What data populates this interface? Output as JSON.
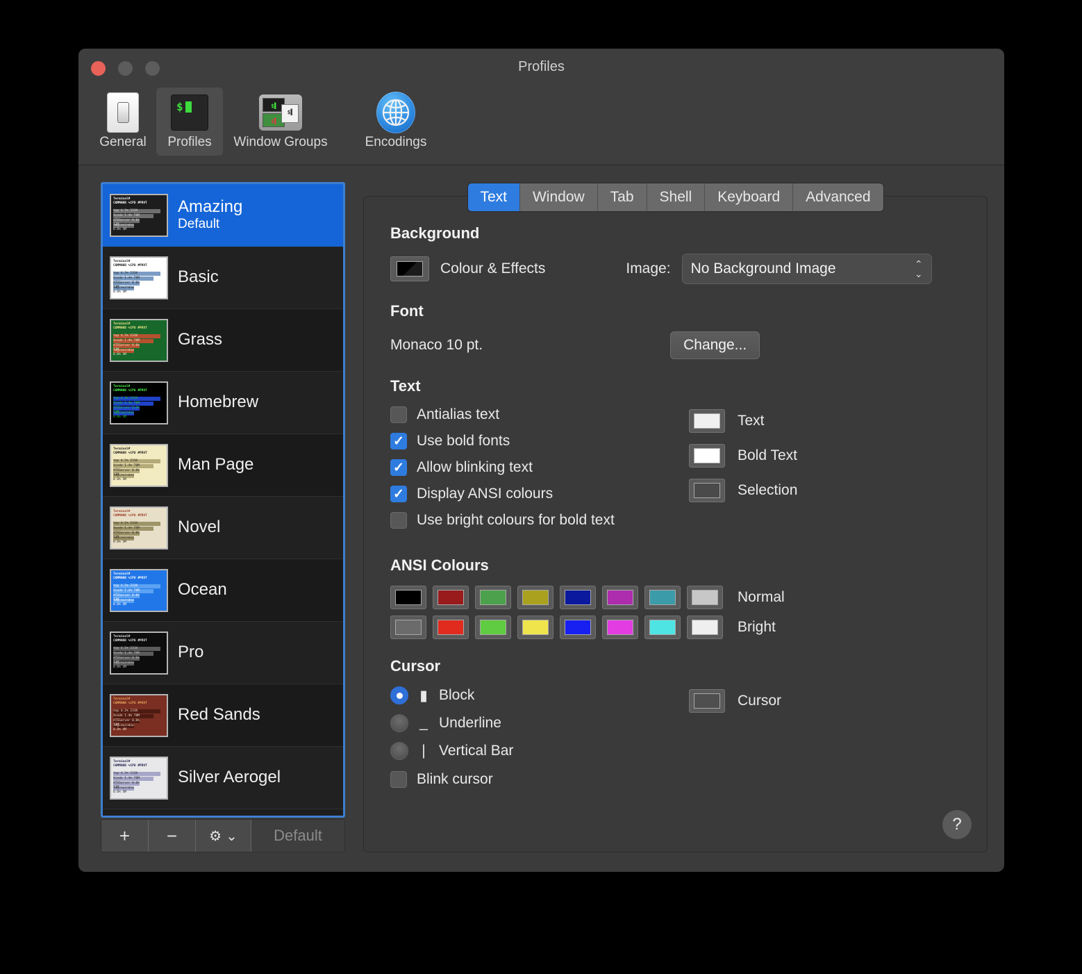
{
  "window": {
    "title": "Profiles",
    "traffic": {
      "close": "close-button",
      "minimize": "minimize-button",
      "zoom": "zoom-button"
    }
  },
  "toolbar": {
    "items": [
      {
        "label": "General",
        "icon": "light-switch-icon",
        "selected": false
      },
      {
        "label": "Profiles",
        "icon": "terminal-window-icon",
        "selected": true
      },
      {
        "label": "Window Groups",
        "icon": "window-group-icon",
        "selected": false
      },
      {
        "label": "Encodings",
        "icon": "globe-icon",
        "selected": false
      }
    ]
  },
  "sidebar": {
    "profiles": [
      {
        "name": "Amazing",
        "subtitle": "Default",
        "selected": true,
        "theme": {
          "bg": "#1d1d1d",
          "fg": "#d8d8d8",
          "bar": "#6e6e6e",
          "hdr": "#ffffff"
        }
      },
      {
        "name": "Basic",
        "subtitle": "",
        "selected": false,
        "theme": {
          "bg": "#ffffff",
          "fg": "#222222",
          "bar": "#7b9cc4",
          "hdr": "#1a1a1a"
        }
      },
      {
        "name": "Grass",
        "subtitle": "",
        "selected": false,
        "theme": {
          "bg": "#17682a",
          "fg": "#e8e8c8",
          "bar": "#b5512f",
          "hdr": "#f0e68c"
        }
      },
      {
        "name": "Homebrew",
        "subtitle": "",
        "selected": false,
        "theme": {
          "bg": "#000000",
          "fg": "#21c421",
          "bar": "#1f42c8",
          "hdr": "#4fff4f"
        }
      },
      {
        "name": "Man Page",
        "subtitle": "",
        "selected": false,
        "theme": {
          "bg": "#f2eac0",
          "fg": "#1d1d1d",
          "bar": "#b5ab7a",
          "hdr": "#1a1a1a"
        }
      },
      {
        "name": "Novel",
        "subtitle": "",
        "selected": false,
        "theme": {
          "bg": "#e7dfc8",
          "fg": "#3b2e22",
          "bar": "#9d9468",
          "hdr": "#a03a28"
        }
      },
      {
        "name": "Ocean",
        "subtitle": "",
        "selected": false,
        "theme": {
          "bg": "#2277e8",
          "fg": "#ffffff",
          "bar": "#5ba2f2",
          "hdr": "#ffffff"
        }
      },
      {
        "name": "Pro",
        "subtitle": "",
        "selected": false,
        "theme": {
          "bg": "#0d0d0d",
          "fg": "#c2c2c2",
          "bar": "#5a5a5a",
          "hdr": "#e6e6e6"
        }
      },
      {
        "name": "Red Sands",
        "subtitle": "",
        "selected": false,
        "theme": {
          "bg": "#7a2f22",
          "fg": "#f0dcc8",
          "bar": "#4d1b12",
          "hdr": "#e8a35a"
        }
      },
      {
        "name": "Silver Aerogel",
        "subtitle": "",
        "selected": false,
        "theme": {
          "bg": "#e8e8ea",
          "fg": "#2a2a2a",
          "bar": "#a6a6c8",
          "hdr": "#1a1a4a"
        }
      }
    ],
    "thumbnail_text": {
      "prompt": "Terminal#",
      "header": "COMMAND",
      "col1": "%CPU",
      "col2": "#PRVT",
      "rows": [
        {
          "name": "top",
          "cpu": "4.2%",
          "mem": "231K"
        },
        {
          "name": "Xcode",
          "cpu": "1.4%",
          "mem": "78M"
        },
        {
          "name": "ATSServer",
          "cpu": "0.0%",
          "mem": "13M"
        },
        {
          "name": "loginwindow",
          "cpu": "0.0%",
          "mem": "4M"
        }
      ],
      "footer": "Terminal #"
    },
    "list_toolbar": {
      "add": "+",
      "remove": "−",
      "gear": "⚙",
      "gear_chevron": "⌄",
      "default_label": "Default"
    }
  },
  "panel": {
    "tabs": [
      {
        "label": "Text",
        "active": true
      },
      {
        "label": "Window",
        "active": false
      },
      {
        "label": "Tab",
        "active": false
      },
      {
        "label": "Shell",
        "active": false
      },
      {
        "label": "Keyboard",
        "active": false
      },
      {
        "label": "Advanced",
        "active": false
      }
    ],
    "background": {
      "title": "Background",
      "colour_effects_label": "Colour & Effects",
      "colour_well": "#000000",
      "image_label": "Image:",
      "image_value": "No Background Image"
    },
    "font": {
      "title": "Font",
      "value": "Monaco 10 pt.",
      "change_label": "Change..."
    },
    "text": {
      "title": "Text",
      "checkboxes": [
        {
          "label": "Antialias text",
          "checked": false
        },
        {
          "label": "Use bold fonts",
          "checked": true
        },
        {
          "label": "Allow blinking text",
          "checked": true
        },
        {
          "label": "Display ANSI colours",
          "checked": true
        },
        {
          "label": "Use bright colours for bold text",
          "checked": false
        }
      ],
      "swatches": [
        {
          "label": "Text",
          "colour": "#f0f0f0"
        },
        {
          "label": "Bold Text",
          "colour": "#ffffff"
        },
        {
          "label": "Selection",
          "colour": "#4a4a4a"
        }
      ]
    },
    "ansi": {
      "title": "ANSI Colours",
      "rows": [
        {
          "label": "Normal",
          "colours": [
            "#000000",
            "#991b1b",
            "#4ca24c",
            "#aaa21e",
            "#0b199e",
            "#ae2cae",
            "#3c9ba8",
            "#c7c7c7"
          ]
        },
        {
          "label": "Bright",
          "colours": [
            "#6b6b6b",
            "#e02b1e",
            "#5fcc41",
            "#efe44c",
            "#1720f0",
            "#e23ce2",
            "#4fe4e4",
            "#efefef"
          ]
        }
      ]
    },
    "cursor": {
      "title": "Cursor",
      "options": [
        {
          "label": "Block",
          "glyph": "▮",
          "selected": true
        },
        {
          "label": "Underline",
          "glyph": "_",
          "selected": false
        },
        {
          "label": "Vertical Bar",
          "glyph": "|",
          "selected": false
        }
      ],
      "blink": {
        "label": "Blink cursor",
        "checked": false
      },
      "swatch": {
        "label": "Cursor",
        "colour": "#4f4f4f"
      }
    },
    "help_label": "?"
  }
}
